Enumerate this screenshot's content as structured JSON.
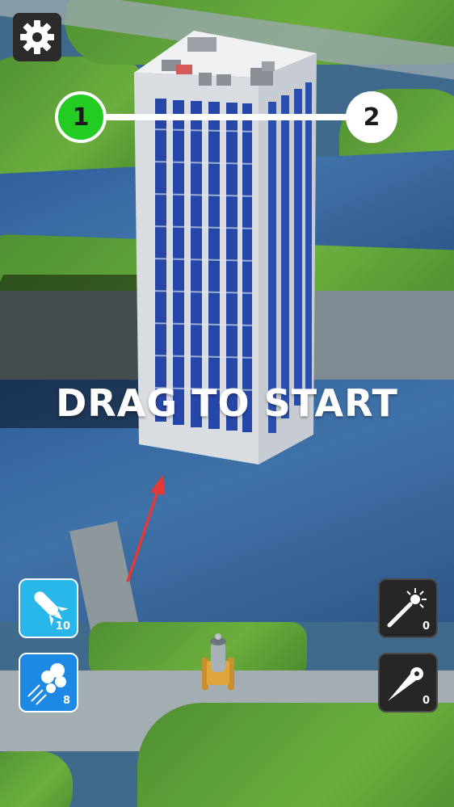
{
  "hud": {
    "settings_icon": "gear-icon",
    "steps": [
      {
        "label": "1",
        "state": "active",
        "color": "#22cc22"
      },
      {
        "label": "2",
        "state": "inactive",
        "color": "#ffffff"
      }
    ]
  },
  "prompt": {
    "text": "DRAG TO START"
  },
  "powerups": {
    "left": [
      {
        "icon": "missile-icon",
        "count": "10",
        "color": "#29b6e8"
      },
      {
        "icon": "cluster-shot-icon",
        "count": "8",
        "color": "#1e88e5"
      }
    ],
    "right": [
      {
        "icon": "spark-wand-icon",
        "count": "0",
        "color": "#262626"
      },
      {
        "icon": "comet-icon",
        "count": "0",
        "color": "#262626"
      }
    ]
  },
  "player": {
    "icon": "cannon-icon"
  },
  "aim_indicator": {
    "icon": "aim-arrow-icon",
    "color": "#e53935"
  }
}
